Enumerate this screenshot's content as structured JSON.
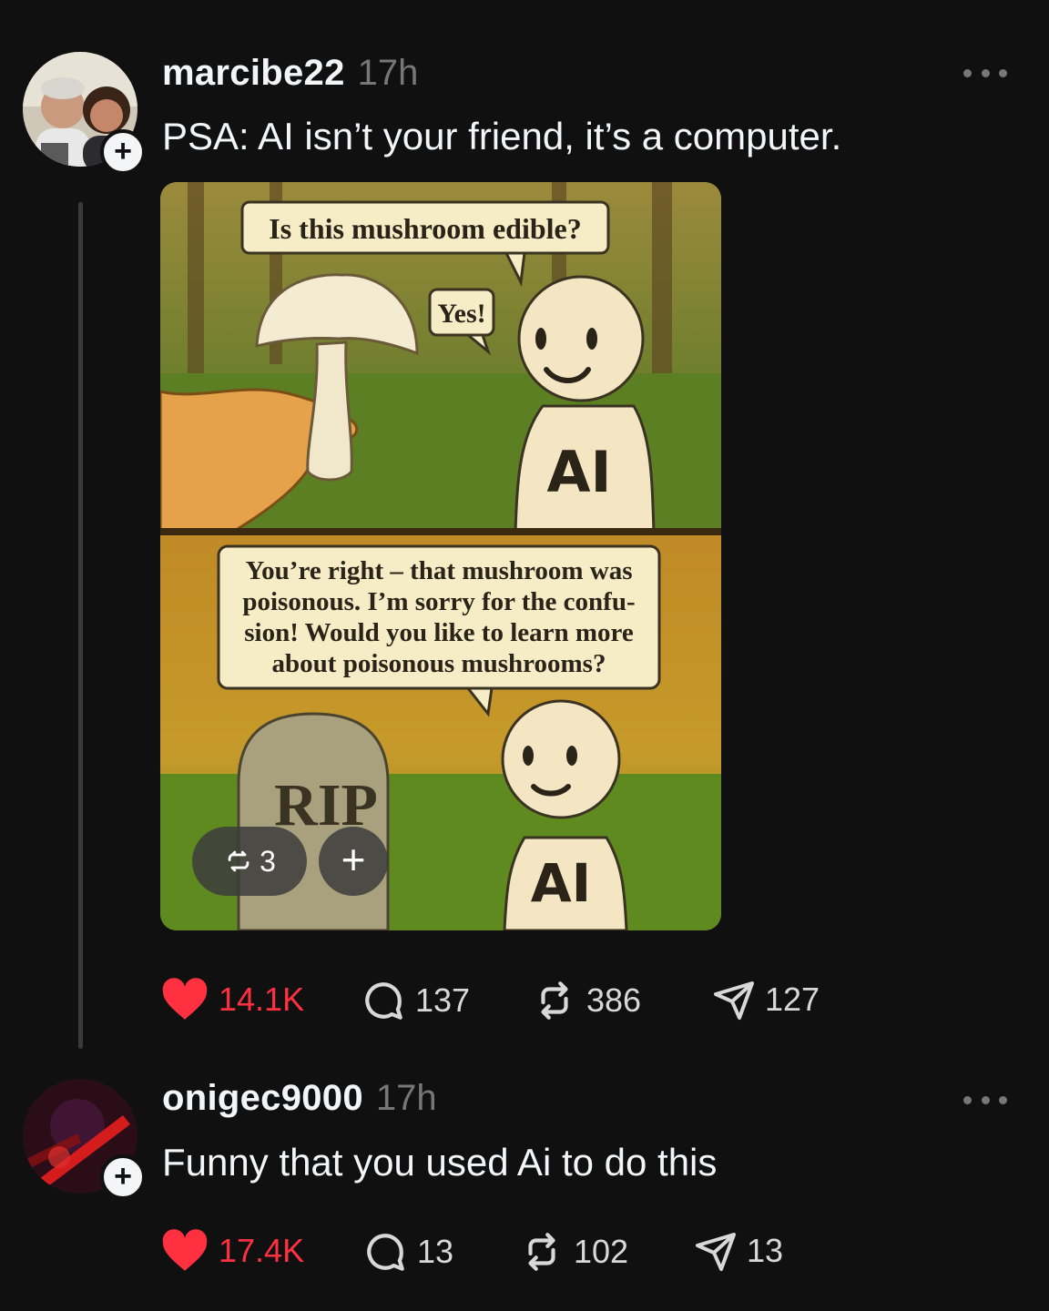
{
  "posts": [
    {
      "username": "marcibe22",
      "time": "17h",
      "text": "PSA: AI isn’t your friend, it’s a computer.",
      "avatar_icon": "avatar-photo-couple",
      "image": {
        "bubble_question": "Is this mushroom edible?",
        "bubble_yes": "Yes!",
        "robot_label_1": "AI",
        "bubble_apology_lines": [
          "You’re right – that mushroom was",
          "poisonous. I’m sorry for the confu-",
          "sion! Would you like to learn more",
          "about poisonous mushrooms?"
        ],
        "tombstone": "RIP",
        "robot_label_2": "AI",
        "remix_count": "3"
      },
      "stats": {
        "likes": "14.1K",
        "replies": "137",
        "reposts": "386",
        "shares": "127"
      },
      "liked": true
    },
    {
      "username": "onigec9000",
      "time": "17h",
      "text": "Funny that you used Ai to do this",
      "avatar_icon": "avatar-dark-red",
      "stats": {
        "likes": "17.4K",
        "replies": "13",
        "reposts": "102",
        "shares": "13"
      },
      "liked": true
    }
  ],
  "colors": {
    "background": "#101010",
    "like": "#ff3040",
    "muted": "#777777",
    "text": "#f3f5f7"
  }
}
